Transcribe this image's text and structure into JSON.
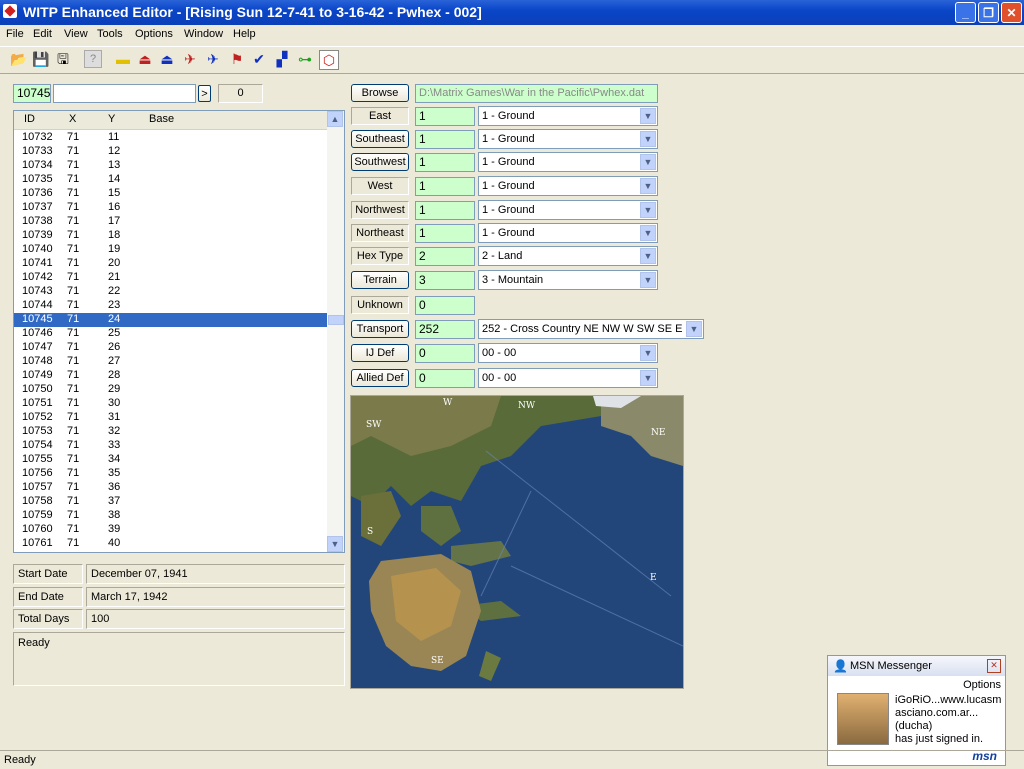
{
  "window": {
    "title": "WITP Enhanced Editor - [Rising Sun  12-7-41 to 3-16-42 - Pwhex - 002]"
  },
  "menu": [
    "File",
    "Edit",
    "View",
    "Tools",
    "Options",
    "Window",
    "Help"
  ],
  "search": {
    "id_value": "10745",
    "text_value": "",
    "next_label": ">",
    "count_value": "0"
  },
  "list": {
    "columns": [
      "ID",
      "X",
      "Y",
      "Base"
    ],
    "rows": [
      [
        "10732",
        "71",
        "11"
      ],
      [
        "10733",
        "71",
        "12"
      ],
      [
        "10734",
        "71",
        "13"
      ],
      [
        "10735",
        "71",
        "14"
      ],
      [
        "10736",
        "71",
        "15"
      ],
      [
        "10737",
        "71",
        "16"
      ],
      [
        "10738",
        "71",
        "17"
      ],
      [
        "10739",
        "71",
        "18"
      ],
      [
        "10740",
        "71",
        "19"
      ],
      [
        "10741",
        "71",
        "20"
      ],
      [
        "10742",
        "71",
        "21"
      ],
      [
        "10743",
        "71",
        "22"
      ],
      [
        "10744",
        "71",
        "23"
      ],
      [
        "10745",
        "71",
        "24"
      ],
      [
        "10746",
        "71",
        "25"
      ],
      [
        "10747",
        "71",
        "26"
      ],
      [
        "10748",
        "71",
        "27"
      ],
      [
        "10749",
        "71",
        "28"
      ],
      [
        "10750",
        "71",
        "29"
      ],
      [
        "10751",
        "71",
        "30"
      ],
      [
        "10752",
        "71",
        "31"
      ],
      [
        "10753",
        "71",
        "32"
      ],
      [
        "10754",
        "71",
        "33"
      ],
      [
        "10755",
        "71",
        "34"
      ],
      [
        "10756",
        "71",
        "35"
      ],
      [
        "10757",
        "71",
        "36"
      ],
      [
        "10758",
        "71",
        "37"
      ],
      [
        "10759",
        "71",
        "38"
      ],
      [
        "10760",
        "71",
        "39"
      ],
      [
        "10761",
        "71",
        "40"
      ]
    ],
    "selected_id": "10745"
  },
  "info": {
    "start_label": "Start Date",
    "start_value": "December 07, 1941",
    "end_label": "End Date",
    "end_value": "March 17, 1942",
    "days_label": "Total Days",
    "days_value": "100",
    "log": "Ready"
  },
  "file": {
    "browse_label": "Browse",
    "path": "D:\\Matrix Games\\War in the Pacific\\Pwhex.dat"
  },
  "fields": [
    {
      "label": "East",
      "value": "1",
      "combo": "1 - Ground",
      "is_button": false
    },
    {
      "label": "Southeast",
      "value": "1",
      "combo": "1 - Ground",
      "is_button": true
    },
    {
      "label": "Southwest",
      "value": "1",
      "combo": "1 - Ground",
      "is_button": true
    },
    {
      "label": "West",
      "value": "1",
      "combo": "1 - Ground",
      "is_button": false
    },
    {
      "label": "Northwest",
      "value": "1",
      "combo": "1 - Ground",
      "is_button": false
    },
    {
      "label": "Northeast",
      "value": "1",
      "combo": "1 - Ground",
      "is_button": false
    },
    {
      "label": "Hex Type",
      "value": "2",
      "combo": "2 - Land",
      "is_button": false
    },
    {
      "label": "Terrain",
      "value": "3",
      "combo": "3 - Mountain",
      "is_button": true
    },
    {
      "label": "Unknown",
      "value": "0",
      "combo": "",
      "is_button": false
    },
    {
      "label": "Transport",
      "value": "252",
      "combo": "252 - Cross Country NE NW W SW SE E",
      "is_button": true
    },
    {
      "label": "IJ Def",
      "value": "0",
      "combo": "00 - 00",
      "is_button": true
    },
    {
      "label": "Allied Def",
      "value": "0",
      "combo": "00 - 00",
      "is_button": true
    }
  ],
  "map": {
    "labels": [
      "W",
      "NW",
      "NE",
      "SW",
      "S",
      "E",
      "SE"
    ]
  },
  "msn": {
    "title": "MSN Messenger",
    "options": "Options",
    "line1": "iGoRiO...www.lucasm",
    "line2": "asciano.com.ar...",
    "line3": "(ducha)",
    "line4": "has just signed in.",
    "logo": "msn"
  },
  "status": "Ready"
}
